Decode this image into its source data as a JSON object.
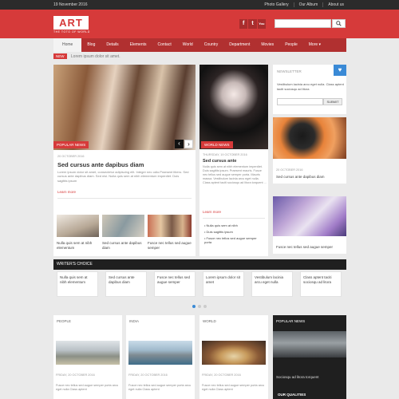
{
  "topbar": {
    "date": "19 November 2016",
    "links": [
      "Photo Gallery",
      "Our Album",
      "About us"
    ]
  },
  "header": {
    "logo": "ART",
    "tagline": "THE TOTO OF WORLD",
    "social": [
      "f",
      "t",
      "You"
    ],
    "search_placeholder": "",
    "search_icon": "search-icon"
  },
  "nav": {
    "items": [
      "Home",
      "Blog",
      "Details",
      "Elements",
      "Contact",
      "World",
      "Country",
      "Department",
      "Movies",
      "People",
      "More ▾"
    ]
  },
  "ticker": {
    "badge": "NEW",
    "text": "Lorem ipsum dolor sit amet."
  },
  "feature": {
    "label": "POPULAR NEWS",
    "date": "20 OCTOBER 2016",
    "title": "Sed cursus ante dapibus diam",
    "body": "Lorem ipsum dolor sit amet, consectetur adipiscing elit. Integer nec odio.Praesent libero. Sed cursus ante dapibus diam. Sed nisi. Nulla quis sem at nibh elementum imperdiet. Duis sagittis ipsum",
    "read_more": "Learn more"
  },
  "thumbs": [
    {
      "title": "Nulla quis sem at nibh elementum"
    },
    {
      "title": "Sed cursus ante dapibus diam"
    },
    {
      "title": "Fusce nec tellus sed augue semper"
    }
  ],
  "world": {
    "label": "WORLD NEWS",
    "date": "THURSDAY, 19 OCTOBER 2016",
    "title": "Sed cursus ante",
    "body": "Nulla quis sem at nibh elementum imperdiet. Duis sagittis ipsum. Praesent mauris. Fusce nec tellus sed augue semper porta. Mauris massa. Vestibulum lacinia arcu eget nulla. Class aptent taciti sociosqu ad litora torquent ...",
    "read_more": "Learn more",
    "bullets": [
      "Nulla quis sem at nibh",
      "Duis sagittis ipsum",
      "Fusce nec tellus sed augue semper porta"
    ]
  },
  "newsletter": {
    "title": "NEWSLETTER",
    "body": "Vestibulum lacinia arcu eget nulla. Class aptent taciti sociosqu ad litora",
    "button": "SUBMIT"
  },
  "side1": {
    "date": "20 OCTOBER 2016",
    "title": "Sed cursus ante dapibus diam"
  },
  "side2": {
    "title": "Fusce nec tellus sed augue semper"
  },
  "writers": {
    "title": "WRITER'S CHOICE",
    "items": [
      "Nulla quis sem at nibh elementum",
      "Sed cursus ante dapibus diam",
      "Fusce nec tellus sed augue semper",
      "Lorem ipsum dolor sit amet",
      "Vestibulum lacinia arcu eget nulla",
      "Class aptent taciti sociosqu ad litora"
    ]
  },
  "bottom": [
    {
      "label": "PEOPLE",
      "date": "FRIDAY, 20 OCTOBER 2016",
      "body": "Fusce nec tellus sed augue semper porta arcu eget nulla Class aptent"
    },
    {
      "label": "INDIA",
      "date": "FRIDAY, 20 OCTOBER 2016",
      "body": "Fusce nec tellus sed augue semper porta arcu eget nulla Class aptent"
    },
    {
      "label": "WORLD",
      "date": "FRIDAY, 20 OCTOBER 2016",
      "body": "Fusce nec tellus sed augue semper porta arcu eget nulla Class aptent"
    }
  ],
  "popular": {
    "title": "POPULAR NEWS",
    "caption": "Sociosqu ad litora torquent",
    "next": "OUR QUALITIES"
  }
}
